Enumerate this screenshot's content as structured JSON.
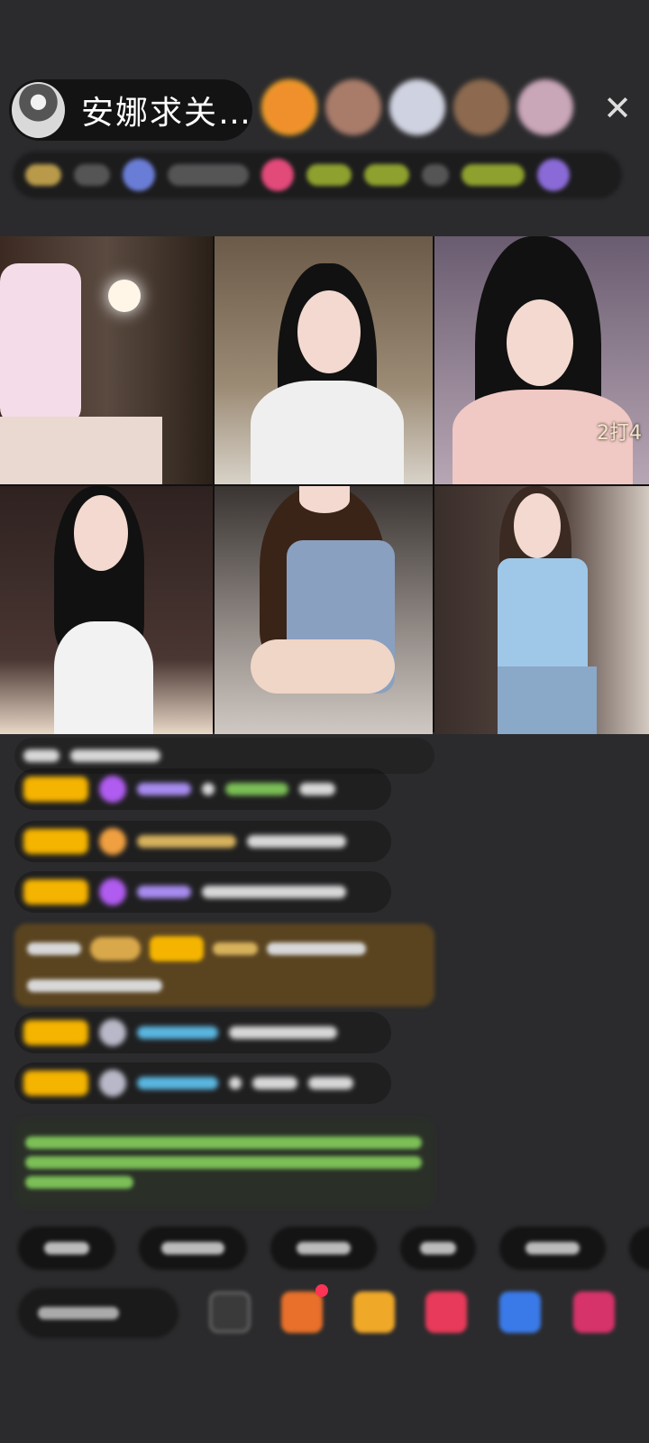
{
  "header": {
    "host_name": "安娜求关…",
    "close_glyph": "✕"
  },
  "viewers": [
    {
      "name": "viewer-avatar-1",
      "color": "#f0902c"
    },
    {
      "name": "viewer-avatar-2",
      "color": "#a97c6a"
    },
    {
      "name": "viewer-avatar-3",
      "color": "#cfd2e0"
    },
    {
      "name": "viewer-avatar-4",
      "color": "#8d6a4f"
    },
    {
      "name": "viewer-avatar-5",
      "color": "#c9a6b8"
    }
  ],
  "grid": {
    "tile_label": "2打4"
  },
  "colors": {
    "accent_gold": "#f5b400",
    "gem_purple": "#b05cf0",
    "background": "#2b2b2d"
  }
}
